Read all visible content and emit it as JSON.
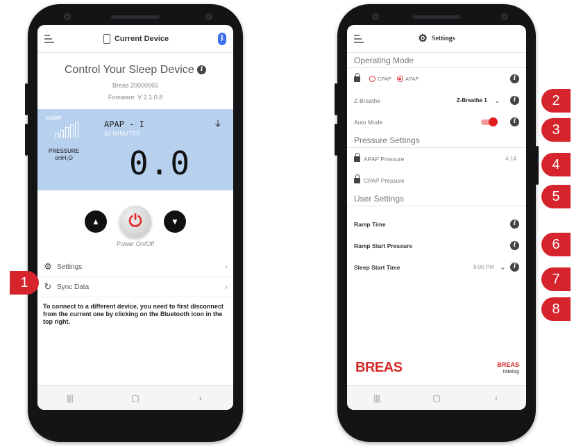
{
  "left_phone": {
    "header": {
      "title": "Current Device",
      "bluetooth_glyph": "ᛒ"
    },
    "control_title": "Control Your Sleep Device",
    "serial": "Breas 20000065",
    "firmware": "Firmware: V 2.1.0.8",
    "lcd": {
      "ramp_label": "RAMP",
      "mode": "APAP - I",
      "time": "30 MINUTES",
      "pressure_label_1": "PRESSURE",
      "pressure_label_2": "cmH₂O",
      "pressure_value": "0.0"
    },
    "power_label": "Power On/Off",
    "menu": [
      {
        "label": "Settings",
        "icon": "gear-icon"
      },
      {
        "label": "Sync Data",
        "icon": "sync-icon"
      }
    ],
    "note": "To connect to a different device, you need to first disconnect from the current one by clicking on the Bluetooth icon in the top right."
  },
  "right_phone": {
    "header": {
      "title": "Settings"
    },
    "operating_mode": {
      "title": "Operating Mode",
      "options": [
        "CPAP",
        "APAP"
      ],
      "selected": "APAP"
    },
    "z_breathe": {
      "label": "Z-Breathe",
      "value": "Z-Breathe 1"
    },
    "auto_mode": {
      "label": "Auto Mode",
      "on": true
    },
    "pressure_settings": {
      "title": "Pressure Settings",
      "apap_label": "APAP Pressure",
      "apap_value": "4-14",
      "cpap_label": "CPAP Pressure"
    },
    "user_settings": {
      "title": "User Settings",
      "ramp_time": "Ramp Time",
      "ramp_start": "Ramp Start Pressure",
      "sleep_start": "Sleep Start Time",
      "sleep_start_value": "8:00 PM"
    },
    "brand_left": "BREAS",
    "brand_right_1": "BREAS",
    "brand_right_2": "Nitelog"
  },
  "callouts": [
    "1",
    "2",
    "3",
    "4",
    "5",
    "6",
    "7",
    "8"
  ],
  "nav_glyphs": {
    "recents": "|||",
    "home": "▢",
    "back": "‹"
  },
  "colors": {
    "accent": "#d5242c",
    "lcd": "#b6d0ee",
    "bluetooth": "#3d6ff0"
  }
}
